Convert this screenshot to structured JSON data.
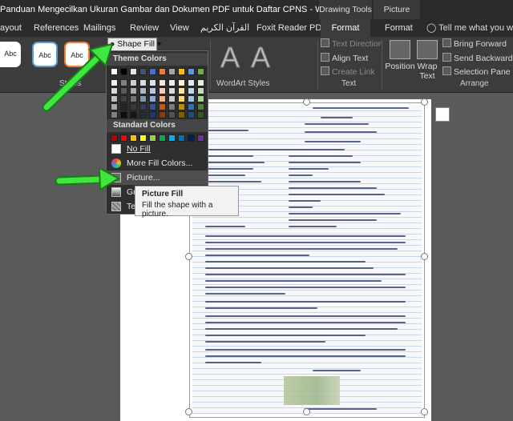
{
  "window": {
    "title": "Panduan Mengecilkan Ukuran Gambar dan Dokumen PDF untuk Daftar CPNS - Word",
    "context_groups": [
      "Drawing Tools",
      "Picture Tools"
    ]
  },
  "tabs": {
    "layout": "ayout",
    "references": "References",
    "mailings": "Mailings",
    "review": "Review",
    "view": "View",
    "arabic": "القرآن الكريم",
    "foxit": "Foxit Reader PDF",
    "format_drawing": "Format",
    "format_picture": "Format",
    "tell_me": "Tell me what you want"
  },
  "ribbon": {
    "shape_style_sample": "Abc",
    "shape_fill_label": "Shape Fill",
    "group_shape_styles": "Styles",
    "group_wordart_styles": "WordArt Styles",
    "wordart_letter": "A",
    "text_direction": "Text Direction",
    "align_text": "Align Text",
    "create_link": "Create Link",
    "group_text": "Text",
    "position_line1": "Position",
    "position_line2": "",
    "wrap_line1": "Wrap",
    "wrap_line2": "Text",
    "bring_forward": "Bring Forward",
    "send_backward": "Send Backward",
    "selection_pane": "Selection Pane",
    "group_arrange": "Arrange"
  },
  "dropdown": {
    "theme_colors_header": "Theme Colors",
    "standard_colors_header": "Standard Colors",
    "theme_top_row": [
      "#ffffff",
      "#000000",
      "#e7e6e6",
      "#44546a",
      "#4472c4",
      "#ed7d31",
      "#a5a5a5",
      "#ffc000",
      "#5b9bd5",
      "#70ad47"
    ],
    "theme_shade_columns": [
      [
        "#f2f2f2",
        "#d9d9d9",
        "#bfbfbf",
        "#a6a6a6",
        "#808080"
      ],
      [
        "#808080",
        "#595959",
        "#404040",
        "#262626",
        "#0d0d0d"
      ],
      [
        "#d0cece",
        "#aeabab",
        "#757171",
        "#3b3838",
        "#171616"
      ],
      [
        "#d6dce5",
        "#adb9ca",
        "#8497b0",
        "#333f50",
        "#222a35"
      ],
      [
        "#dae3f3",
        "#b4c7e7",
        "#8faadc",
        "#2f5597",
        "#203864"
      ],
      [
        "#fbe5d6",
        "#f8cbad",
        "#f4b183",
        "#c55a11",
        "#843c0c"
      ],
      [
        "#ededed",
        "#dbdbdb",
        "#c9c9c9",
        "#7b7b7b",
        "#525252"
      ],
      [
        "#fff2cc",
        "#ffe699",
        "#ffd966",
        "#bf9000",
        "#7f6000"
      ],
      [
        "#deebf7",
        "#bdd7ee",
        "#9dc3e6",
        "#2e75b6",
        "#1f4e79"
      ],
      [
        "#e2f0d9",
        "#c5e0b4",
        "#a9d18e",
        "#548235",
        "#385723"
      ]
    ],
    "standard_row": [
      "#c00000",
      "#ff0000",
      "#ffc000",
      "#ffff00",
      "#92d050",
      "#00b050",
      "#00b0f0",
      "#0070c0",
      "#002060",
      "#7030a0"
    ],
    "no_fill": "No Fill",
    "more_fill_colors": "More Fill Colors...",
    "picture": "Picture...",
    "gradient": "Gr",
    "texture": "Te"
  },
  "tooltip": {
    "title": "Picture Fill",
    "body": "Fill the shape with a picture."
  }
}
